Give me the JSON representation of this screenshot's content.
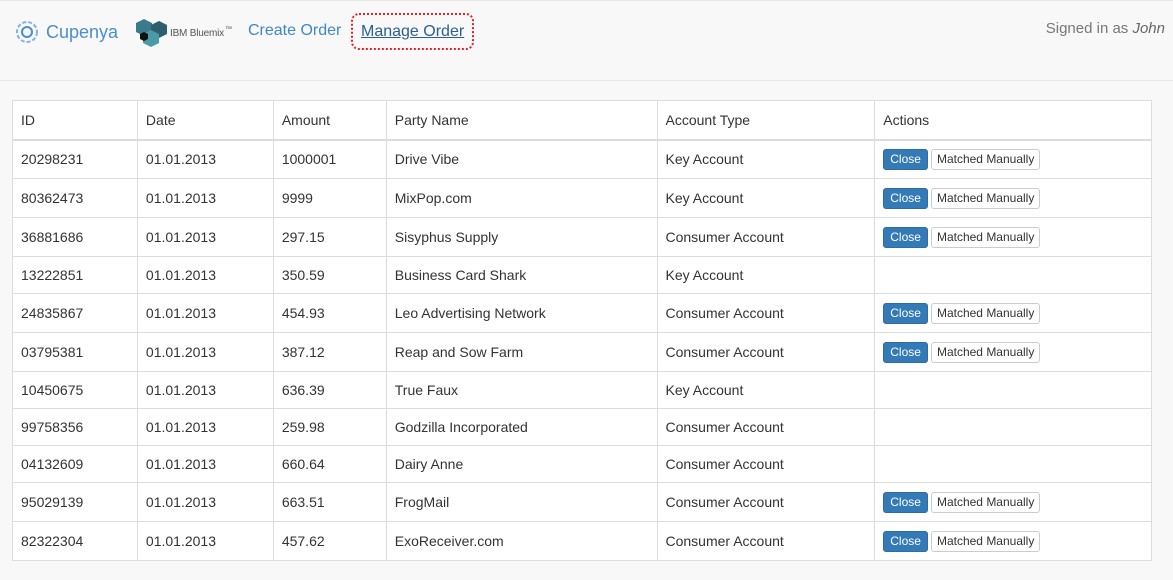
{
  "header": {
    "brand": "Cupenya",
    "partner": "IBM Bluemix",
    "partner_tm": "™",
    "nav": {
      "create_order": "Create Order",
      "manage_order": "Manage Order"
    },
    "signed_in_prefix": "Signed in as",
    "user": "John"
  },
  "table": {
    "columns": [
      "ID",
      "Date",
      "Amount",
      "Party Name",
      "Account Type",
      "Actions"
    ],
    "close_label": "Close",
    "matched_label": "Matched Manually",
    "rows": [
      {
        "id": "20298231",
        "date": "01.01.2013",
        "amount": "1000001",
        "party": "Drive Vibe",
        "account": "Key Account",
        "actions": true
      },
      {
        "id": "80362473",
        "date": "01.01.2013",
        "amount": "9999",
        "party": "MixPop.com",
        "account": "Key Account",
        "actions": true
      },
      {
        "id": "36881686",
        "date": "01.01.2013",
        "amount": "297.15",
        "party": "Sisyphus Supply",
        "account": "Consumer Account",
        "actions": true
      },
      {
        "id": "13222851",
        "date": "01.01.2013",
        "amount": "350.59",
        "party": "Business Card Shark",
        "account": "Key Account",
        "actions": false
      },
      {
        "id": "24835867",
        "date": "01.01.2013",
        "amount": "454.93",
        "party": "Leo Advertising Network",
        "account": "Consumer Account",
        "actions": true
      },
      {
        "id": "03795381",
        "date": "01.01.2013",
        "amount": "387.12",
        "party": "Reap and Sow Farm",
        "account": "Consumer Account",
        "actions": true
      },
      {
        "id": "10450675",
        "date": "01.01.2013",
        "amount": "636.39",
        "party": "True Faux",
        "account": "Key Account",
        "actions": false
      },
      {
        "id": "99758356",
        "date": "01.01.2013",
        "amount": "259.98",
        "party": "Godzilla Incorporated",
        "account": "Consumer Account",
        "actions": false
      },
      {
        "id": "04132609",
        "date": "01.01.2013",
        "amount": "660.64",
        "party": "Dairy Anne",
        "account": "Consumer Account",
        "actions": false
      },
      {
        "id": "95029139",
        "date": "01.01.2013",
        "amount": "663.51",
        "party": "FrogMail",
        "account": "Consumer Account",
        "actions": true
      },
      {
        "id": "82322304",
        "date": "01.01.2013",
        "amount": "457.62",
        "party": "ExoReceiver.com",
        "account": "Consumer Account",
        "actions": true
      }
    ]
  },
  "colors": {
    "brand": "#4a8fcb",
    "link": "#3e87c9",
    "primary_button": "#337ab7",
    "focus_outline": "#e0232b"
  }
}
